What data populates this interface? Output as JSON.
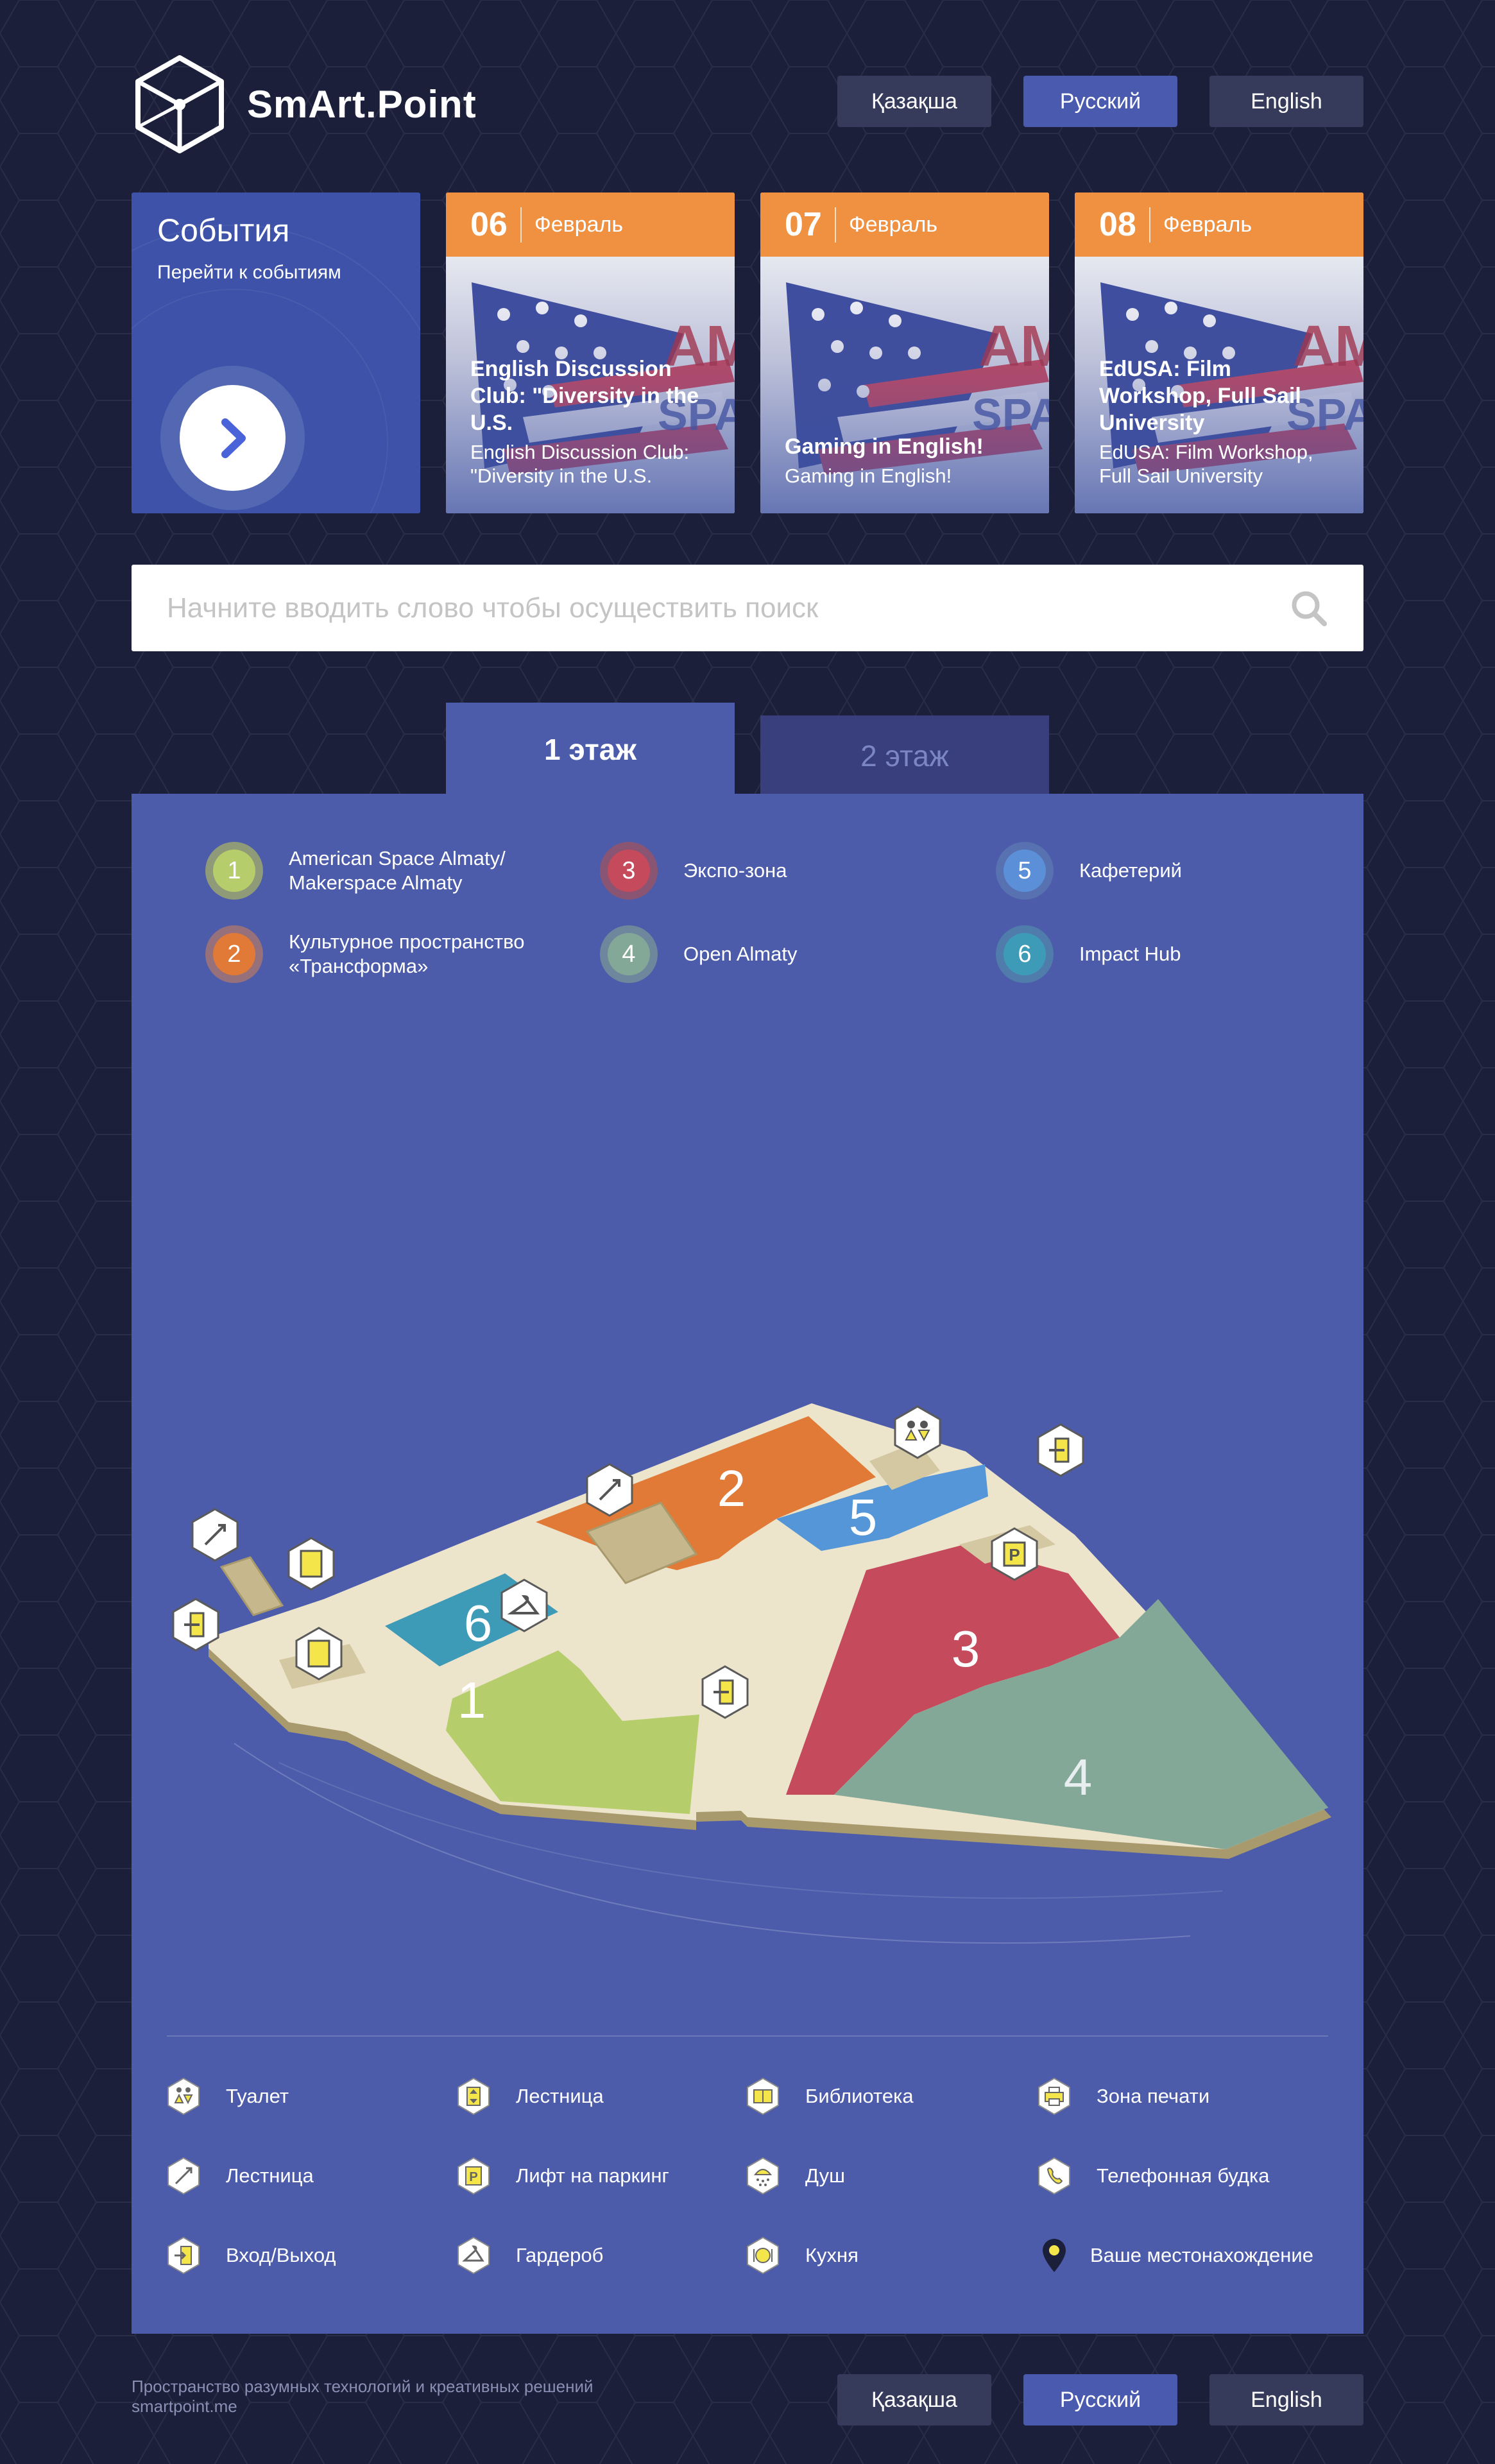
{
  "brand": {
    "name": "SmArt.Point"
  },
  "languages": [
    {
      "label": "Қазақша",
      "active": false
    },
    {
      "label": "Русский",
      "active": true
    },
    {
      "label": "English",
      "active": false
    }
  ],
  "events": {
    "title": "События",
    "link": "Перейти к событиям",
    "cards": [
      {
        "day": "06",
        "month": "Февраль",
        "title": "English Discussion Club: \"Diversity in the U.S.",
        "subtitle": "English Discussion Club: \"Diversity in the U.S."
      },
      {
        "day": "07",
        "month": "Февраль",
        "title": "Gaming in English!",
        "subtitle": "Gaming in English!"
      },
      {
        "day": "08",
        "month": "Февраль",
        "title": "EdUSA: Film Workshop, Full Sail University",
        "subtitle": "EdUSA: Film Workshop, Full Sail University"
      }
    ]
  },
  "search": {
    "placeholder": "Начните вводить слово чтобы осуществить поиск",
    "value": ""
  },
  "floors": {
    "tabs": [
      {
        "label": "1 этаж",
        "active": true
      },
      {
        "label": "2 этаж",
        "active": false
      }
    ]
  },
  "zones": [
    {
      "num": "1",
      "label": "American Space Almaty/ Makerspace Almaty",
      "color": "#b5cd6a",
      "ring": "#8f9a78"
    },
    {
      "num": "3",
      "label": "Экспо-зона",
      "color": "#c44a5c",
      "ring": "#8a5572"
    },
    {
      "num": "5",
      "label": "Кафетерий",
      "color": "#5b90d8",
      "ring": "#5871b0"
    },
    {
      "num": "2",
      "label": "Культурное пространство «Трансформа»",
      "color": "#e07a36",
      "ring": "#96707a"
    },
    {
      "num": "4",
      "label": "Open Almaty",
      "color": "#84a898",
      "ring": "#6f879c"
    },
    {
      "num": "6",
      "label": "Impact Hub",
      "color": "#3e9bb8",
      "ring": "#4f7cab"
    }
  ],
  "map": {
    "zone_numbers": [
      "1",
      "2",
      "3",
      "4",
      "5",
      "6"
    ]
  },
  "legend": [
    {
      "label": "Туалет",
      "icon": "toilet-icon"
    },
    {
      "label": "Лестница",
      "icon": "stairs-icon"
    },
    {
      "label": "Библиотека",
      "icon": "library-icon"
    },
    {
      "label": "Зона печати",
      "icon": "print-icon"
    },
    {
      "label": "Лестница",
      "icon": "escalator-icon"
    },
    {
      "label": "Лифт на паркинг",
      "icon": "parking-lift-icon"
    },
    {
      "label": "Душ",
      "icon": "shower-icon"
    },
    {
      "label": "Телефонная будка",
      "icon": "phone-icon"
    },
    {
      "label": "Вход/Выход",
      "icon": "entrance-icon"
    },
    {
      "label": "Гардероб",
      "icon": "wardrobe-icon"
    },
    {
      "label": "Кухня",
      "icon": "kitchen-icon"
    },
    {
      "label": "Ваше местонахождение",
      "icon": "location-pin-icon"
    }
  ],
  "footer": {
    "line1": "Пространство разумных технологий и креативных решений",
    "line2": "smartpoint.me"
  },
  "colors": {
    "background": "#1b1f3a",
    "panel": "#4c5caa",
    "accent_orange": "#ef9140",
    "button": "#363b5c",
    "button_active": "#4a5aae"
  }
}
